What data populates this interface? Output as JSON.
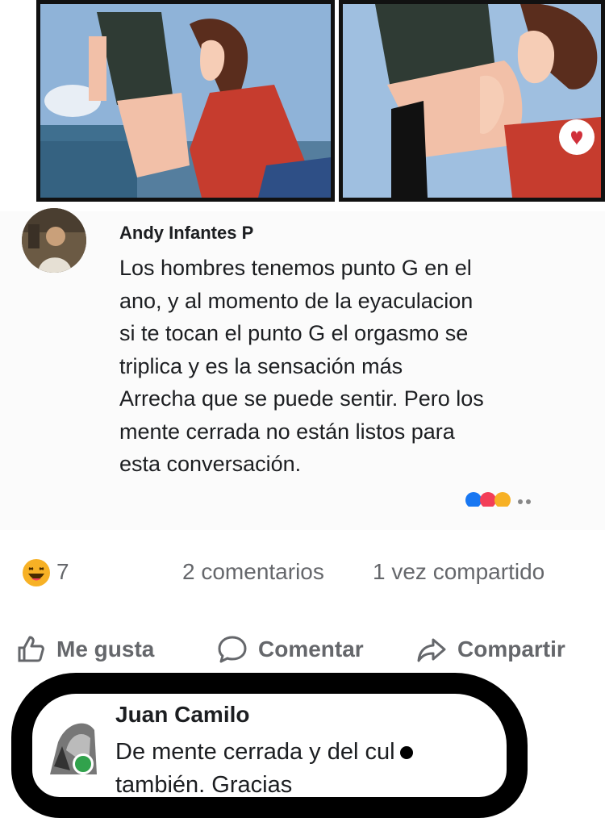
{
  "post_comment": {
    "author": "Andy Infantes P",
    "text": "Los hombres tenemos punto G en el\nano, y al momento de la eyaculacion\nsi te tocan el punto G el orgasmo se\ntriplica y es la sensación más\nArrecha que se puede sentir. Pero los\nmente cerrada no están listos para\nesta conversación."
  },
  "stats": {
    "reaction_icon": "haha-emoji-icon",
    "reaction_count": "7",
    "comments": "2 comentarios",
    "shares": "1 vez compartido"
  },
  "actions": {
    "like": "Me gusta",
    "comment": "Comentar",
    "share": "Compartir"
  },
  "reply": {
    "author": "Juan Camilo",
    "text": "De mente cerrada y del cul",
    "text_line2": "también. Gracias",
    "online_color": "#31a24c"
  },
  "colors": {
    "secondary_text": "#65676b",
    "primary_text": "#1c1e21"
  }
}
